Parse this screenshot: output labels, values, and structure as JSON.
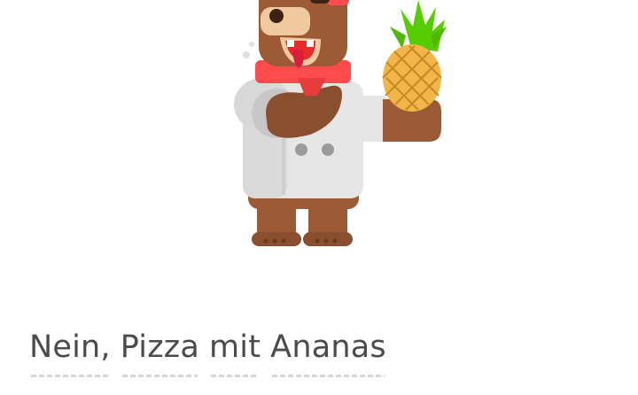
{
  "illustration": {
    "character": "bear-chef-with-pineapple",
    "colors": {
      "fur": "#9c5b35",
      "fur_dark": "#7a4428",
      "coat": "#e6e6e6",
      "coat_shadow": "#cfcfcf",
      "scarf": "#ff4b4b",
      "tongue": "#ea2b2b",
      "pineapple_body": "#f2b547",
      "pineapple_leaves": "#58cc02"
    }
  },
  "sentence": {
    "words": [
      "Nein,",
      "Pizza",
      "mit",
      "Ananas"
    ],
    "text_color": "#4b4b4b",
    "underline_color": "#d6d6d6"
  }
}
